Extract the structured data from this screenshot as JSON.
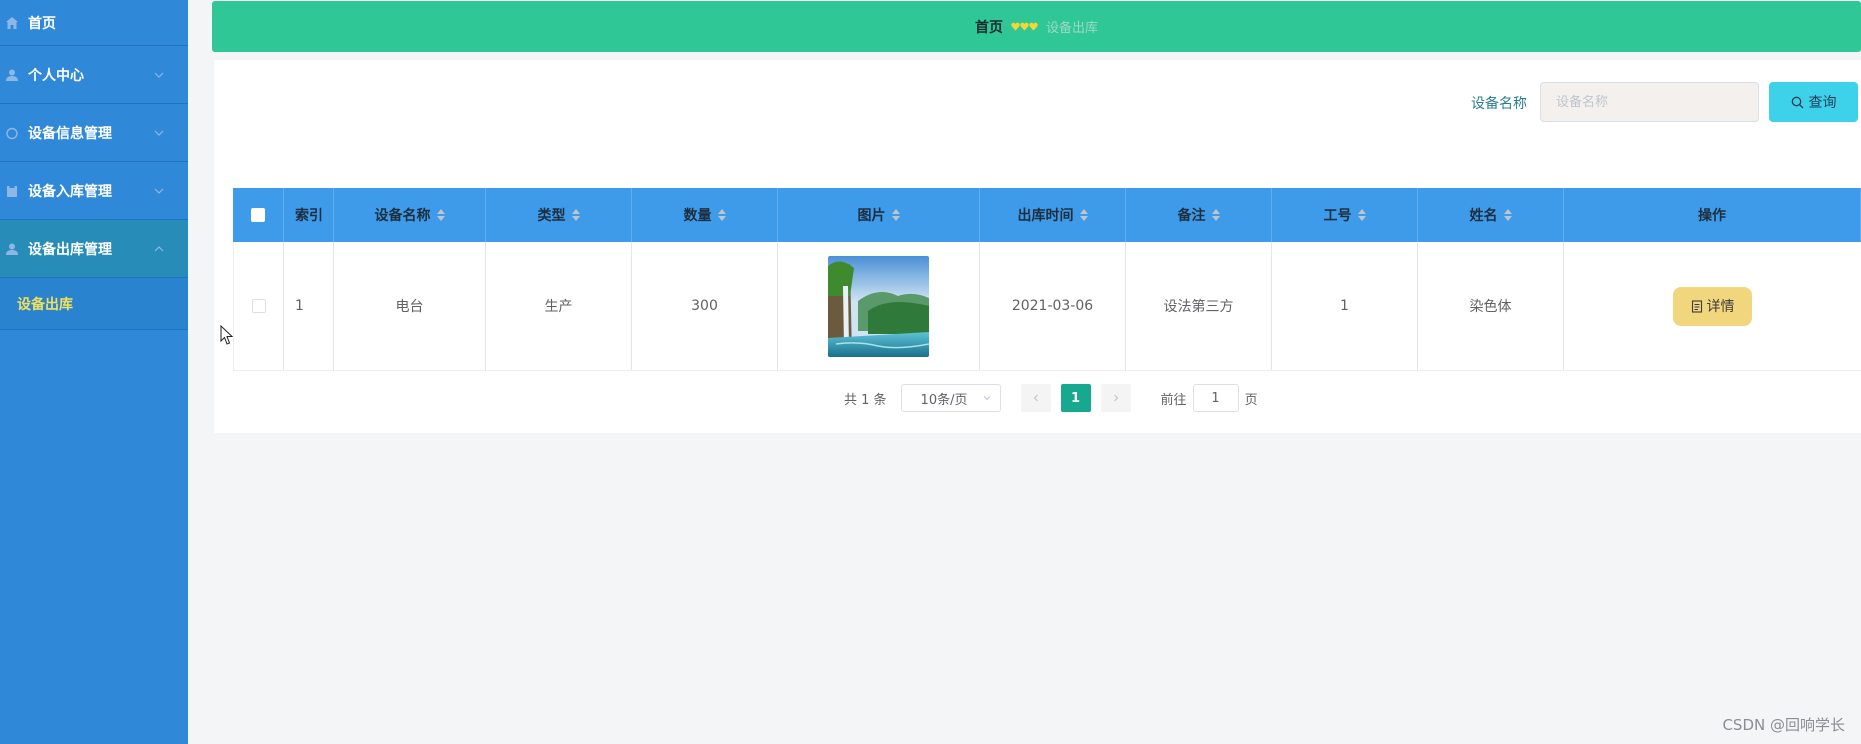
{
  "sidebar": {
    "items": [
      {
        "label": "首页",
        "icon": "home-icon"
      },
      {
        "label": "个人中心",
        "icon": "user-icon"
      },
      {
        "label": "设备信息管理",
        "icon": "power-icon"
      },
      {
        "label": "设备入库管理",
        "icon": "clipboard-icon"
      },
      {
        "label": "设备出库管理",
        "icon": "user-icon",
        "active": true
      }
    ],
    "submenu": [
      {
        "label": "设备出库",
        "active": true
      }
    ]
  },
  "breadcrumb": {
    "home": "首页",
    "current": "设备出库",
    "separator_icon": "hearts-icon"
  },
  "search": {
    "label": "设备名称",
    "placeholder": "设备名称",
    "value": "",
    "button_label": "查询"
  },
  "table": {
    "columns": [
      "索引",
      "设备名称",
      "类型",
      "数量",
      "图片",
      "出库时间",
      "备注",
      "工号",
      "姓名",
      "操作"
    ],
    "rows": [
      {
        "index": "1",
        "name": "电台",
        "type": "生产",
        "quantity": "300",
        "image": "waterfall-landscape",
        "time": "2021-03-06",
        "note": "设法第三方",
        "work_no": "1",
        "person": "染色体",
        "action": "详情"
      }
    ]
  },
  "pagination": {
    "total": "共 1 条",
    "page_size": "10条/页",
    "current_page": "1",
    "goto_label": "前往",
    "goto_value": "1",
    "goto_suffix": "页"
  },
  "watermark": "CSDN @回响学长",
  "colors": {
    "sidebar": "#2f89d8",
    "breadcrumb": "#2fc795",
    "table_header": "#3e9be9",
    "search_button": "#3ed2ea",
    "detail_button": "#f2d67e",
    "active_page": "#17a890",
    "submenu_text": "#f2e05a"
  }
}
